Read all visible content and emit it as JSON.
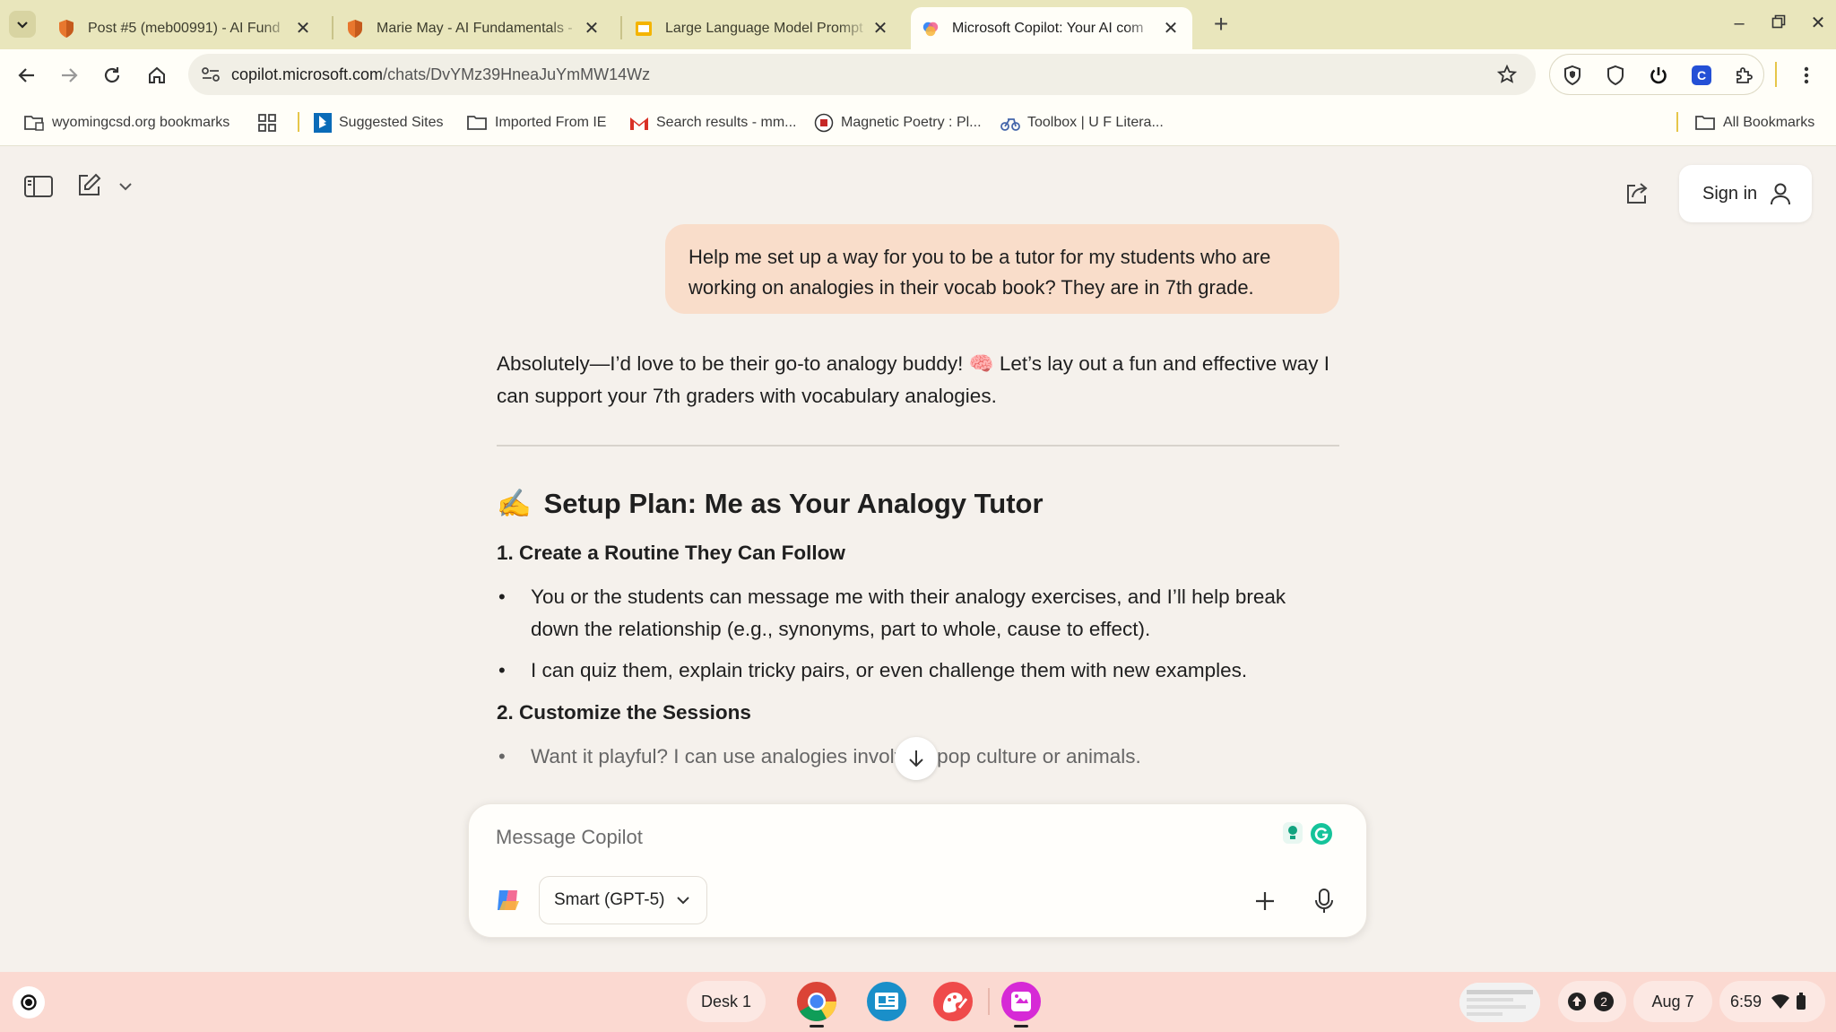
{
  "browser": {
    "tabs": [
      {
        "title": "Post #5 (meb00991) - AI Fund",
        "icon": "shield-favicon"
      },
      {
        "title": "Marie May - AI Fundamentals -",
        "icon": "shield-favicon"
      },
      {
        "title": "Large Language Model Prompt",
        "icon": "slides-favicon"
      },
      {
        "title": "Microsoft Copilot: Your AI com",
        "icon": "copilot-favicon",
        "active": true
      }
    ],
    "url_host": "copilot.microsoft.com",
    "url_path": "/chats/DvYMz39HneaJuYmMW14Wz",
    "bookmarks": [
      {
        "label": "wyomingcsd.org bookmarks",
        "icon": "managed-folder-icon"
      },
      {
        "label": "",
        "icon": "apps-grid-icon"
      },
      {
        "label": "Suggested Sites",
        "icon": "bing-icon"
      },
      {
        "label": "Imported From IE",
        "icon": "folder-icon"
      },
      {
        "label": "Search results - mm...",
        "icon": "gmail-icon"
      },
      {
        "label": "Magnetic Poetry : Pl...",
        "icon": "magnetic-poetry-icon"
      },
      {
        "label": "Toolbox | U F Litera...",
        "icon": "toolbox-icon"
      }
    ],
    "all_bookmarks_label": "All Bookmarks"
  },
  "copilot": {
    "sign_in_label": "Sign in",
    "user_message": "Help me set up a way for you to be a tutor for my students who are working on analogies in their vocab book? They are in 7th grade.",
    "response": {
      "intro_a": "Absolutely—I’d love to be their go-to analogy buddy! ",
      "intro_emoji": "🧠",
      "intro_b": " Let’s lay out a fun and effective way I can support your 7th graders with vocabulary analogies.",
      "heading_emoji": "✍️",
      "heading": "Setup Plan: Me as Your Analogy Tutor",
      "section1_title": "1. Create a Routine They Can Follow",
      "section1_items": [
        "You or the students can message me with their analogy exercises, and I’ll help break down the relationship (e.g., synonyms, part to whole, cause to effect).",
        "I can quiz them, explain tricky pairs, or even challenge them with new examples."
      ],
      "section2_title": "2. Customize the Sessions",
      "section2_items": [
        "Want it playful? I can use analogies involving pop culture or animals."
      ]
    },
    "composer": {
      "placeholder": "Message Copilot",
      "model_label": "Smart (GPT-5)"
    }
  },
  "shelf": {
    "desk_label": "Desk 1",
    "notification_count": "2",
    "date": "Aug 7",
    "time": "6:59"
  }
}
